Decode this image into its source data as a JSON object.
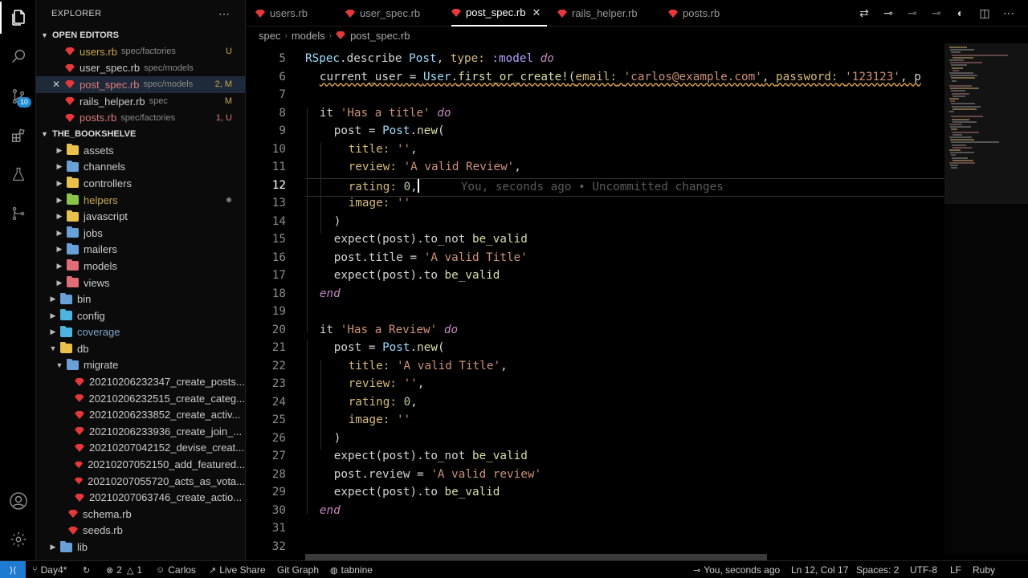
{
  "sidebar": {
    "title": "EXPLORER",
    "open_editors_label": "OPEN EDITORS",
    "project_label": "THE_BOOKSHELVE",
    "open_editors": [
      {
        "name": "users.rb",
        "desc": "spec/factories",
        "status": "U"
      },
      {
        "name": "user_spec.rb",
        "desc": "spec/models",
        "status": ""
      },
      {
        "name": "post_spec.rb",
        "desc": "spec/models",
        "status": "2, M"
      },
      {
        "name": "rails_helper.rb",
        "desc": "spec",
        "status": "M"
      },
      {
        "name": "posts.rb",
        "desc": "spec/factories",
        "status": "1, U"
      }
    ],
    "tree": {
      "assets": "assets",
      "channels": "channels",
      "controllers": "controllers",
      "helpers": "helpers",
      "javascript": "javascript",
      "jobs": "jobs",
      "mailers": "mailers",
      "models": "models",
      "views": "views",
      "bin": "bin",
      "config": "config",
      "coverage": "coverage",
      "db": "db",
      "migrate": "migrate",
      "migrations": [
        "20210206232347_create_posts...",
        "20210206232515_create_categ...",
        "20210206233852_create_activ...",
        "20210206233936_create_join_...",
        "20210207042152_devise_creat...",
        "20210207052150_add_featured...",
        "20210207055720_acts_as_vota...",
        "20210207063746_create_actio..."
      ],
      "schema": "schema.rb",
      "seeds": "seeds.rb",
      "lib": "lib"
    }
  },
  "tabs": [
    "users.rb",
    "user_spec.rb",
    "post_spec.rb",
    "rails_helper.rb",
    "posts.rb"
  ],
  "breadcrumb": [
    "spec",
    "models",
    "post_spec.rb"
  ],
  "editor": {
    "line_numbers": [
      "5",
      "6",
      "7",
      "8",
      "9",
      "10",
      "11",
      "12",
      "13",
      "14",
      "15",
      "16",
      "17",
      "18",
      "19",
      "20",
      "21",
      "22",
      "23",
      "24",
      "25",
      "26",
      "27",
      "28",
      "29",
      "30",
      "31",
      "32"
    ],
    "current_line": "12",
    "blame": "You, seconds ago • Uncommitted changes",
    "lines": {
      "l5": [
        "RSpec",
        ".describe ",
        "Post",
        ", ",
        "type:",
        " :model ",
        "do"
      ],
      "l6": [
        "current_user",
        " = ",
        "User",
        ".",
        "first_or_create!",
        "(",
        "email:",
        " ",
        "'carlos@example.com'",
        ", ",
        "password:",
        " ",
        "'123123'",
        ", p"
      ],
      "l8": [
        "it ",
        "'Has a title'",
        " ",
        "do"
      ],
      "l9": [
        "post",
        " = ",
        "Post",
        ".",
        "new",
        "("
      ],
      "l10": [
        "title:",
        " ",
        "''",
        ","
      ],
      "l11": [
        "review:",
        " ",
        "'A valid Review'",
        ","
      ],
      "l12": [
        "rating:",
        " ",
        "0",
        ","
      ],
      "l13": [
        "image:",
        " ",
        "''"
      ],
      "l14": [
        ")"
      ],
      "l15": [
        "expect",
        "(",
        "post",
        ").",
        "to_not",
        " ",
        "be_valid"
      ],
      "l16": [
        "post",
        ".",
        "title",
        " = ",
        "'A valid Title'"
      ],
      "l17": [
        "expect",
        "(",
        "post",
        ").",
        "to",
        " ",
        "be_valid"
      ],
      "l18": [
        "end"
      ],
      "l20": [
        "it ",
        "'Has a Review'",
        " ",
        "do"
      ],
      "l21": [
        "post",
        " = ",
        "Post",
        ".",
        "new",
        "("
      ],
      "l22": [
        "title:",
        " ",
        "'A valid Title'",
        ","
      ],
      "l23": [
        "review:",
        " ",
        "''",
        ","
      ],
      "l24": [
        "rating:",
        " ",
        "0",
        ","
      ],
      "l25": [
        "image:",
        " ",
        "''"
      ],
      "l26": [
        ")"
      ],
      "l27": [
        "expect",
        "(",
        "post",
        ").",
        "to_not",
        " ",
        "be_valid"
      ],
      "l28": [
        "post",
        ".",
        "review",
        " = ",
        "'A valid review'"
      ],
      "l29": [
        "expect",
        "(",
        "post",
        ").",
        "to",
        " ",
        "be_valid"
      ],
      "l30": [
        "end"
      ]
    }
  },
  "status": {
    "branch": "Day4*",
    "errors": "2",
    "warnings": "1",
    "user": "Carlos",
    "live_share": "Live Share",
    "git_graph": "Git Graph",
    "tabnine": "tabnine",
    "blame": "You, seconds ago",
    "position": "Ln 12, Col 17",
    "spaces": "Spaces: 2",
    "encoding": "UTF-8",
    "eol": "LF",
    "language": "Ruby"
  },
  "activity_badge": "10",
  "colors": {
    "accent": "#1f7ad2",
    "ruby_icon": "#e5383b",
    "modified": "#c9a84c",
    "folder_blue": "#6aa0d8",
    "folder_yellow": "#e8c04a",
    "folder_red": "#e06c75",
    "folder_green": "#8bc34a"
  }
}
